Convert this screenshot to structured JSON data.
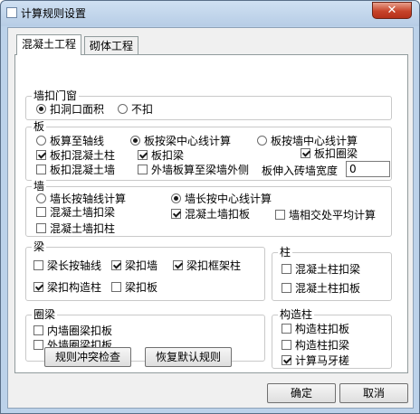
{
  "window": {
    "title": "计算规则设置",
    "close": "✕"
  },
  "tabs": [
    {
      "label": "混凝土工程",
      "active": true
    },
    {
      "label": "砌体工程",
      "active": false
    }
  ],
  "groups": {
    "wall_opening": {
      "title": "墙扣门窗",
      "options": [
        {
          "label": "扣洞口面积",
          "checked": true
        },
        {
          "label": "不扣",
          "checked": false
        }
      ]
    },
    "slab": {
      "title": "板",
      "radios": [
        {
          "label": "板算至轴线",
          "checked": false
        },
        {
          "label": "板按梁中心线计算",
          "checked": true
        },
        {
          "label": "板按墙中心线计算",
          "checked": false
        }
      ],
      "checks": [
        {
          "label": "板扣混凝土柱",
          "checked": true
        },
        {
          "label": "板扣梁",
          "checked": true
        },
        {
          "label": "板扣圈梁",
          "checked": true
        },
        {
          "label": "板扣混凝土墙",
          "checked": false
        },
        {
          "label": "外墙板算至梁墙外侧",
          "checked": false
        }
      ],
      "brick_width_label": "板伸入砖墙宽度",
      "brick_width_value": "0"
    },
    "wall": {
      "title": "墙",
      "radios": [
        {
          "label": "墙长按轴线计算",
          "checked": false
        },
        {
          "label": "墙长按中心线计算",
          "checked": true
        }
      ],
      "checks": [
        {
          "label": "混凝土墙扣梁",
          "checked": false
        },
        {
          "label": "混凝土墙扣板",
          "checked": true
        },
        {
          "label": "墙相交处平均计算",
          "checked": false
        },
        {
          "label": "混凝土墙扣柱",
          "checked": false
        }
      ]
    },
    "beam": {
      "title": "梁",
      "checks": [
        {
          "label": "梁长按轴线",
          "checked": false
        },
        {
          "label": "梁扣墙",
          "checked": true
        },
        {
          "label": "梁扣框架柱",
          "checked": true
        },
        {
          "label": "梁扣构造柱",
          "checked": true
        },
        {
          "label": "梁扣板",
          "checked": false
        }
      ]
    },
    "column": {
      "title": "柱",
      "checks": [
        {
          "label": "混凝土柱扣梁",
          "checked": false
        },
        {
          "label": "混凝土柱扣板",
          "checked": false
        }
      ]
    },
    "ring_beam": {
      "title": "圈梁",
      "checks": [
        {
          "label": "内墙圈梁扣板",
          "checked": false
        },
        {
          "label": "外墙圈梁扣板",
          "checked": false
        }
      ]
    },
    "construct_column": {
      "title": "构造柱",
      "checks": [
        {
          "label": "构造柱扣板",
          "checked": false
        },
        {
          "label": "构造柱扣梁",
          "checked": false
        },
        {
          "label": "计算马牙槎",
          "checked": true
        }
      ]
    }
  },
  "buttons": {
    "conflict_check": "规则冲突检查",
    "restore_default": "恢复默认规则",
    "ok": "确定",
    "cancel": "取消"
  }
}
